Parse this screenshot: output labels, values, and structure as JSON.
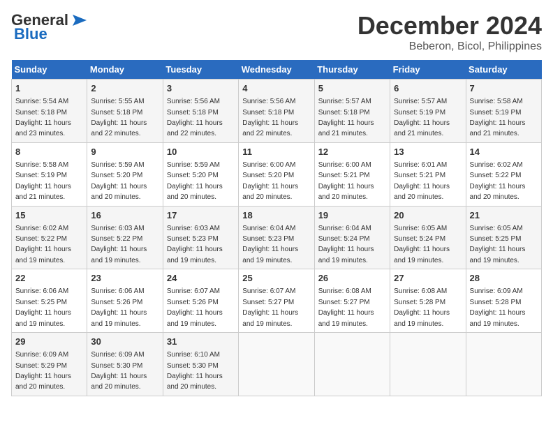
{
  "logo": {
    "text1": "General",
    "text2": "Blue"
  },
  "header": {
    "month": "December 2024",
    "location": "Beberon, Bicol, Philippines"
  },
  "weekdays": [
    "Sunday",
    "Monday",
    "Tuesday",
    "Wednesday",
    "Thursday",
    "Friday",
    "Saturday"
  ],
  "weeks": [
    [
      {
        "day": "1",
        "info": "Sunrise: 5:54 AM\nSunset: 5:18 PM\nDaylight: 11 hours\nand 23 minutes."
      },
      {
        "day": "2",
        "info": "Sunrise: 5:55 AM\nSunset: 5:18 PM\nDaylight: 11 hours\nand 22 minutes."
      },
      {
        "day": "3",
        "info": "Sunrise: 5:56 AM\nSunset: 5:18 PM\nDaylight: 11 hours\nand 22 minutes."
      },
      {
        "day": "4",
        "info": "Sunrise: 5:56 AM\nSunset: 5:18 PM\nDaylight: 11 hours\nand 22 minutes."
      },
      {
        "day": "5",
        "info": "Sunrise: 5:57 AM\nSunset: 5:18 PM\nDaylight: 11 hours\nand 21 minutes."
      },
      {
        "day": "6",
        "info": "Sunrise: 5:57 AM\nSunset: 5:19 PM\nDaylight: 11 hours\nand 21 minutes."
      },
      {
        "day": "7",
        "info": "Sunrise: 5:58 AM\nSunset: 5:19 PM\nDaylight: 11 hours\nand 21 minutes."
      }
    ],
    [
      {
        "day": "8",
        "info": "Sunrise: 5:58 AM\nSunset: 5:19 PM\nDaylight: 11 hours\nand 21 minutes."
      },
      {
        "day": "9",
        "info": "Sunrise: 5:59 AM\nSunset: 5:20 PM\nDaylight: 11 hours\nand 20 minutes."
      },
      {
        "day": "10",
        "info": "Sunrise: 5:59 AM\nSunset: 5:20 PM\nDaylight: 11 hours\nand 20 minutes."
      },
      {
        "day": "11",
        "info": "Sunrise: 6:00 AM\nSunset: 5:20 PM\nDaylight: 11 hours\nand 20 minutes."
      },
      {
        "day": "12",
        "info": "Sunrise: 6:00 AM\nSunset: 5:21 PM\nDaylight: 11 hours\nand 20 minutes."
      },
      {
        "day": "13",
        "info": "Sunrise: 6:01 AM\nSunset: 5:21 PM\nDaylight: 11 hours\nand 20 minutes."
      },
      {
        "day": "14",
        "info": "Sunrise: 6:02 AM\nSunset: 5:22 PM\nDaylight: 11 hours\nand 20 minutes."
      }
    ],
    [
      {
        "day": "15",
        "info": "Sunrise: 6:02 AM\nSunset: 5:22 PM\nDaylight: 11 hours\nand 19 minutes."
      },
      {
        "day": "16",
        "info": "Sunrise: 6:03 AM\nSunset: 5:22 PM\nDaylight: 11 hours\nand 19 minutes."
      },
      {
        "day": "17",
        "info": "Sunrise: 6:03 AM\nSunset: 5:23 PM\nDaylight: 11 hours\nand 19 minutes."
      },
      {
        "day": "18",
        "info": "Sunrise: 6:04 AM\nSunset: 5:23 PM\nDaylight: 11 hours\nand 19 minutes."
      },
      {
        "day": "19",
        "info": "Sunrise: 6:04 AM\nSunset: 5:24 PM\nDaylight: 11 hours\nand 19 minutes."
      },
      {
        "day": "20",
        "info": "Sunrise: 6:05 AM\nSunset: 5:24 PM\nDaylight: 11 hours\nand 19 minutes."
      },
      {
        "day": "21",
        "info": "Sunrise: 6:05 AM\nSunset: 5:25 PM\nDaylight: 11 hours\nand 19 minutes."
      }
    ],
    [
      {
        "day": "22",
        "info": "Sunrise: 6:06 AM\nSunset: 5:25 PM\nDaylight: 11 hours\nand 19 minutes."
      },
      {
        "day": "23",
        "info": "Sunrise: 6:06 AM\nSunset: 5:26 PM\nDaylight: 11 hours\nand 19 minutes."
      },
      {
        "day": "24",
        "info": "Sunrise: 6:07 AM\nSunset: 5:26 PM\nDaylight: 11 hours\nand 19 minutes."
      },
      {
        "day": "25",
        "info": "Sunrise: 6:07 AM\nSunset: 5:27 PM\nDaylight: 11 hours\nand 19 minutes."
      },
      {
        "day": "26",
        "info": "Sunrise: 6:08 AM\nSunset: 5:27 PM\nDaylight: 11 hours\nand 19 minutes."
      },
      {
        "day": "27",
        "info": "Sunrise: 6:08 AM\nSunset: 5:28 PM\nDaylight: 11 hours\nand 19 minutes."
      },
      {
        "day": "28",
        "info": "Sunrise: 6:09 AM\nSunset: 5:28 PM\nDaylight: 11 hours\nand 19 minutes."
      }
    ],
    [
      {
        "day": "29",
        "info": "Sunrise: 6:09 AM\nSunset: 5:29 PM\nDaylight: 11 hours\nand 20 minutes."
      },
      {
        "day": "30",
        "info": "Sunrise: 6:09 AM\nSunset: 5:30 PM\nDaylight: 11 hours\nand 20 minutes."
      },
      {
        "day": "31",
        "info": "Sunrise: 6:10 AM\nSunset: 5:30 PM\nDaylight: 11 hours\nand 20 minutes."
      },
      null,
      null,
      null,
      null
    ]
  ]
}
